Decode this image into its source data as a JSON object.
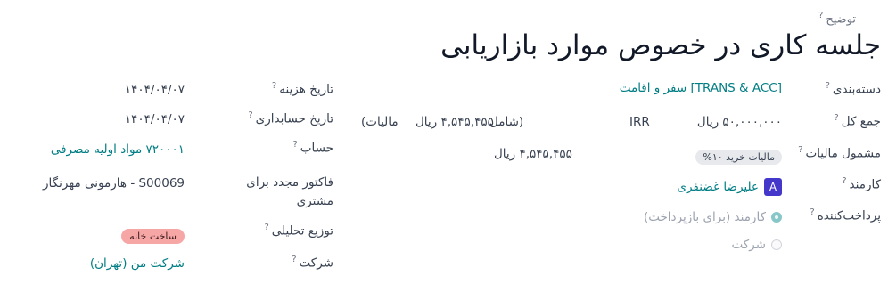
{
  "header": {
    "description_label": "توضیح",
    "title": "جلسه کاری در خصوص موارد بازاریابی"
  },
  "fields": {
    "category": {
      "label": "دسته‌بندی",
      "value": "[TRANS & ACC] سفر و اقامت"
    },
    "total": {
      "label": "جمع کل",
      "amount": "۵۰,۰۰۰,۰۰۰ ریال",
      "currency": "IRR",
      "incl_open": "(شامل",
      "incl_amount": "۴,۵۴۵,۴۵۵ ریال",
      "incl_close": "مالیات)"
    },
    "taxes": {
      "label": "مشمول مالیات",
      "tag": "مالیات خرید ۱۰%",
      "amount": "۴,۵۴۵,۴۵۵ ریال"
    },
    "employee": {
      "label": "کارمند",
      "avatar": "A",
      "name": "علیرضا غضنفری"
    },
    "paid_by": {
      "label": "پرداخت‌کننده",
      "options": [
        "کارمند (برای بازپرداخت)",
        "شرکت"
      ],
      "selected": "کارمند (برای بازپرداخت)"
    },
    "expense_date": {
      "label": "تاریخ هزینه",
      "value": "۱۴۰۴/۰۴/۰۷"
    },
    "accounting_date": {
      "label": "تاریخ حسابداری",
      "value": "۱۴۰۴/۰۴/۰۷"
    },
    "account": {
      "label": "حساب",
      "value": "۷۲۰۰۰۱ مواد اولیه مصرفی"
    },
    "reinvoice": {
      "label_line1": "فاکتور مجدد برای",
      "label_line2": "مشتری",
      "value": "S00069 - هارمونی مهرنگار"
    },
    "analytic": {
      "label": "توزیع تحلیلی",
      "tag": "ساخت خانه"
    },
    "company": {
      "label": "شرکت",
      "value": "شرکت من (تهران)"
    }
  },
  "colors": {
    "link": "#017e84",
    "avatar": "#4338ca",
    "tag_red": "#f7a6a6",
    "tag_gray": "#e7e9ed"
  }
}
